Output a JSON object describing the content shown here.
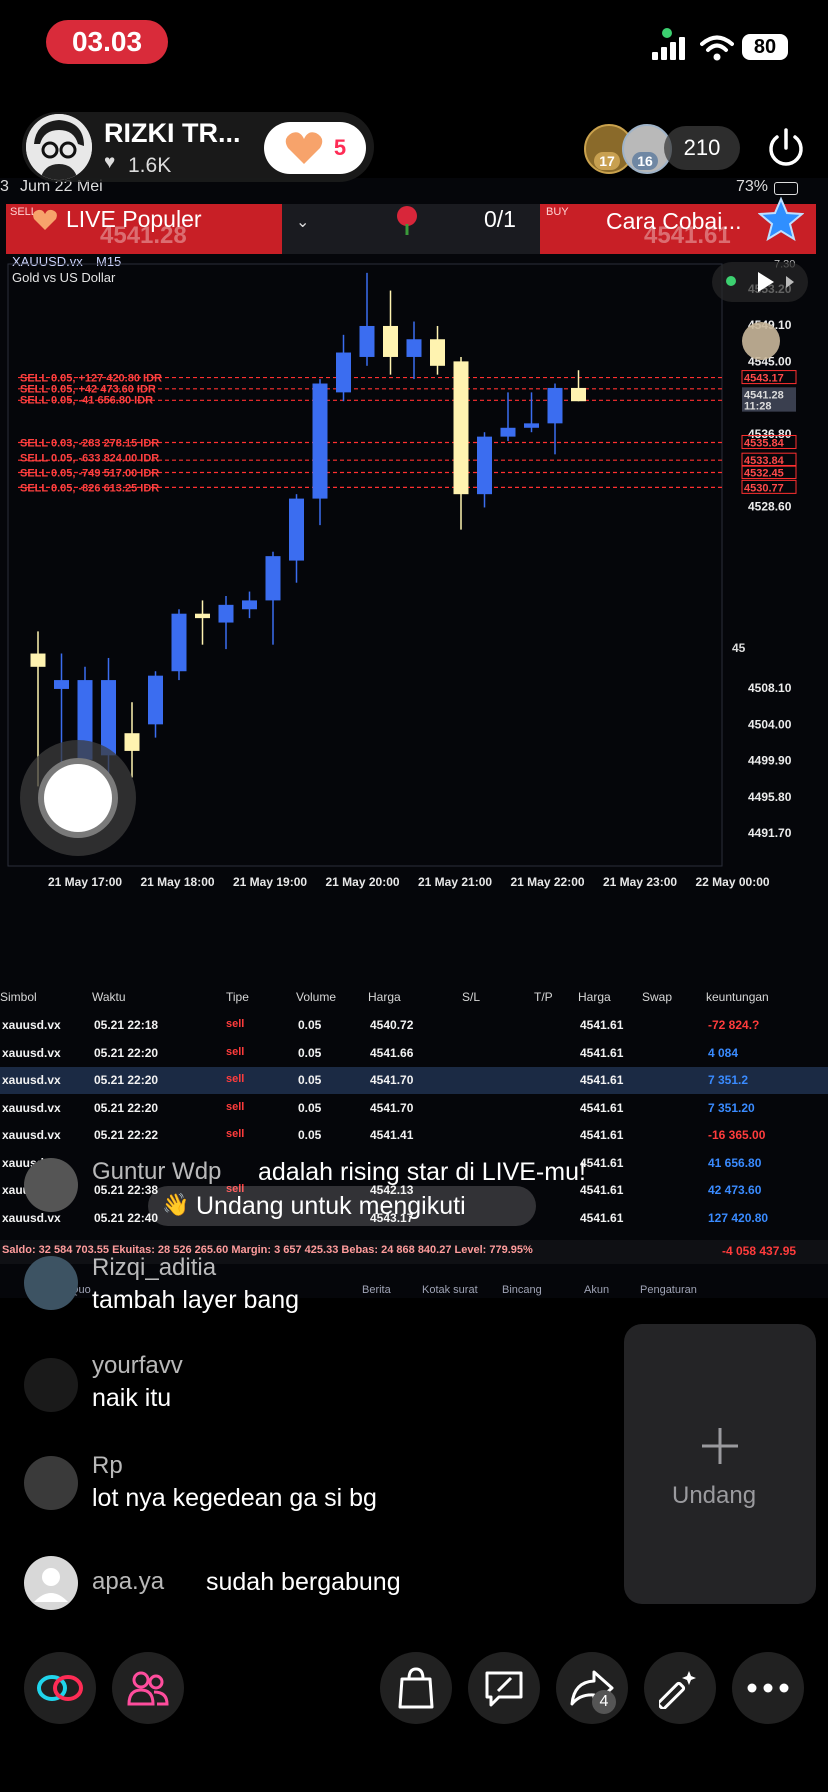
{
  "status_bar": {
    "time": "03.03",
    "battery": "80"
  },
  "host": {
    "name": "RIZKI TR...",
    "likes": "1.6K",
    "like_button_count": "5"
  },
  "viewers": {
    "badge_1": "17",
    "badge_2": "16",
    "count": "210"
  },
  "embedded_phone": {
    "date": "Jum 22 Mei",
    "battery": "73%",
    "left_edge": "3"
  },
  "top_bar": {
    "live_label": "LIVE Populer",
    "gift_progress": "0/1",
    "cara_label": "Cara Cobai...",
    "sell_label": "SELL",
    "buy_label": "BUY",
    "sell_price": "4541.28",
    "buy_price": "4541.61"
  },
  "chart_data": {
    "type": "candlestick",
    "symbol": "XAUUSD.vx",
    "timeframe": "M15",
    "description": "Gold vs US Dollar",
    "x_labels": [
      "21 May 17:00",
      "21 May 18:00",
      "21 May 19:00",
      "21 May 20:00",
      "21 May 21:00",
      "21 May 22:00",
      "21 May 23:00",
      "22 May 00:00"
    ],
    "y_labels": [
      "4553.20",
      "4549.10",
      "4545.00",
      "4536.80",
      "4528.60",
      "4508.10",
      "4504.00",
      "4499.90",
      "4495.80",
      "4491.70"
    ],
    "y_label_top": "7.30",
    "y_label_cut": "45",
    "price_tags": [
      "4543.17",
      "4541.28",
      "11:28",
      "4535.84",
      "4533.84",
      "4532.45",
      "4530.77"
    ],
    "sell_lines": [
      "SELL 0.05, +127 420.80 IDR",
      "SELL 0.05, +42 473.60 IDR",
      "SELL 0.05, -41 656.80 IDR",
      "SELL 0.03, -283 278.15 IDR",
      "SELL 0.05, -633 824.00 IDR",
      "SELL 0.05, -749 517.00 IDR",
      "SELL 0.05, -826 613.25 IDR"
    ],
    "ylim": [
      4488,
      4556
    ],
    "candles": [
      {
        "o": 4512.0,
        "h": 4514.5,
        "l": 4497.0,
        "c": 4510.5
      },
      {
        "o": 4508.0,
        "h": 4512.0,
        "l": 4496.0,
        "c": 4509.0
      },
      {
        "o": 4500.0,
        "h": 4510.5,
        "l": 4494.0,
        "c": 4509.0
      },
      {
        "o": 4500.5,
        "h": 4511.5,
        "l": 4498.0,
        "c": 4509.0
      },
      {
        "o": 4503.0,
        "h": 4506.5,
        "l": 4498.0,
        "c": 4501.0
      },
      {
        "o": 4504.0,
        "h": 4510.0,
        "l": 4502.5,
        "c": 4509.5
      },
      {
        "o": 4510.0,
        "h": 4517.0,
        "l": 4509.0,
        "c": 4516.5
      },
      {
        "o": 4516.5,
        "h": 4518.0,
        "l": 4513.0,
        "c": 4516.0
      },
      {
        "o": 4515.5,
        "h": 4518.5,
        "l": 4512.5,
        "c": 4517.5
      },
      {
        "o": 4517.0,
        "h": 4519.0,
        "l": 4516.0,
        "c": 4518.0
      },
      {
        "o": 4518.0,
        "h": 4523.5,
        "l": 4513.0,
        "c": 4523.0
      },
      {
        "o": 4522.5,
        "h": 4530.0,
        "l": 4520.0,
        "c": 4529.5
      },
      {
        "o": 4529.5,
        "h": 4543.0,
        "l": 4526.5,
        "c": 4542.5
      },
      {
        "o": 4541.5,
        "h": 4548.0,
        "l": 4540.5,
        "c": 4546.0
      },
      {
        "o": 4545.5,
        "h": 4555.0,
        "l": 4544.5,
        "c": 4549.0
      },
      {
        "o": 4549.0,
        "h": 4553.0,
        "l": 4543.5,
        "c": 4545.5
      },
      {
        "o": 4545.5,
        "h": 4549.5,
        "l": 4543.0,
        "c": 4547.5
      },
      {
        "o": 4547.5,
        "h": 4549.0,
        "l": 4543.5,
        "c": 4544.5
      },
      {
        "o": 4545.0,
        "h": 4545.5,
        "l": 4526.0,
        "c": 4530.0
      },
      {
        "o": 4530.0,
        "h": 4537.0,
        "l": 4528.5,
        "c": 4536.5
      },
      {
        "o": 4536.5,
        "h": 4541.5,
        "l": 4536.0,
        "c": 4537.5
      },
      {
        "o": 4537.5,
        "h": 4541.5,
        "l": 4537.0,
        "c": 4538.0
      },
      {
        "o": 4538.0,
        "h": 4542.5,
        "l": 4534.5,
        "c": 4542.0
      },
      {
        "o": 4542.0,
        "h": 4544.0,
        "l": 4540.5,
        "c": 4540.5
      }
    ]
  },
  "table": {
    "headers": [
      "Simbol",
      "Waktu",
      "Tipe",
      "Volume",
      "Harga",
      "S/L",
      "T/P",
      "Harga",
      "Swap",
      "keuntungan"
    ],
    "rows": [
      {
        "symbol": "xauusd.vx",
        "time": "05.21 22:18",
        "type": "sell",
        "volume": "0.05",
        "price": "4540.72",
        "current": "4541.61",
        "profit": "-72 824.?"
      },
      {
        "symbol": "xauusd.vx",
        "time": "05.21 22:20",
        "type": "sell",
        "volume": "0.05",
        "price": "4541.66",
        "current": "4541.61",
        "profit": "4 084"
      },
      {
        "symbol": "xauusd.vx",
        "time": "05.21 22:20",
        "type": "sell",
        "volume": "0.05",
        "price": "4541.70",
        "current": "4541.61",
        "profit": "7 351.2"
      },
      {
        "symbol": "xauusd.vx",
        "time": "05.21 22:20",
        "type": "sell",
        "volume": "0.05",
        "price": "4541.70",
        "current": "4541.61",
        "profit": "7 351.20"
      },
      {
        "symbol": "xauusd.vx",
        "time": "05.21 22:22",
        "type": "sell",
        "volume": "0.05",
        "price": "4541.41",
        "current": "4541.61",
        "profit": "-16 365.00"
      },
      {
        "symbol": "xauusd.vx",
        "time": "",
        "type": "",
        "volume": "",
        "price": "",
        "current": "4541.61",
        "profit": "41 656.80"
      },
      {
        "symbol": "xauu",
        "time": "05.21 22:38",
        "type": "sell",
        "volume": "",
        "price": "4542.13",
        "current": "4541.61",
        "profit": "42 473.60"
      },
      {
        "symbol": "xauusd.vx",
        "time": "05.21 22:40",
        "type": "",
        "volume": "",
        "price": "4543.17",
        "current": "4541.61",
        "profit": "127 420.80"
      }
    ],
    "summary": "Saldo: 32 584 703.55 Ekuitas: 28 526 265.60 Margin: 3 657 425.33 Bebas: 24 868 840.27 Level: 779.95%",
    "summary_total": "-4 058 437.95"
  },
  "mt_nav": [
    "Berita",
    "Kotak surat",
    "Bincang",
    "Akun",
    "Pengaturan"
  ],
  "mt_nav_partial": "Quo",
  "comments": [
    {
      "name": "Guntur Wdp",
      "text": "adalah rising star di LIVE-mu!",
      "action": "Undang untuk mengikuti"
    },
    {
      "name": "Rizqi_aditia",
      "text": "tambah layer bang"
    },
    {
      "name": "yourfavv",
      "text": "naik itu"
    },
    {
      "name": "Rp",
      "text": "lot nya kegedean ga si bg"
    },
    {
      "name": "apa.ya",
      "text": "sudah bergabung"
    }
  ],
  "invite": {
    "label": "Undang"
  },
  "bottom_bar": {
    "share_count": "4"
  },
  "colors": {
    "live_red": "#fe2c55",
    "bull": "#3b6df0",
    "bear": "#fff3b0",
    "sell_red": "#ff3c3c"
  },
  "icons": [
    "collab-icon",
    "people-icon",
    "shopping-bag-icon",
    "edit-chat-icon",
    "share-icon",
    "magic-wand-icon",
    "more-icon"
  ]
}
